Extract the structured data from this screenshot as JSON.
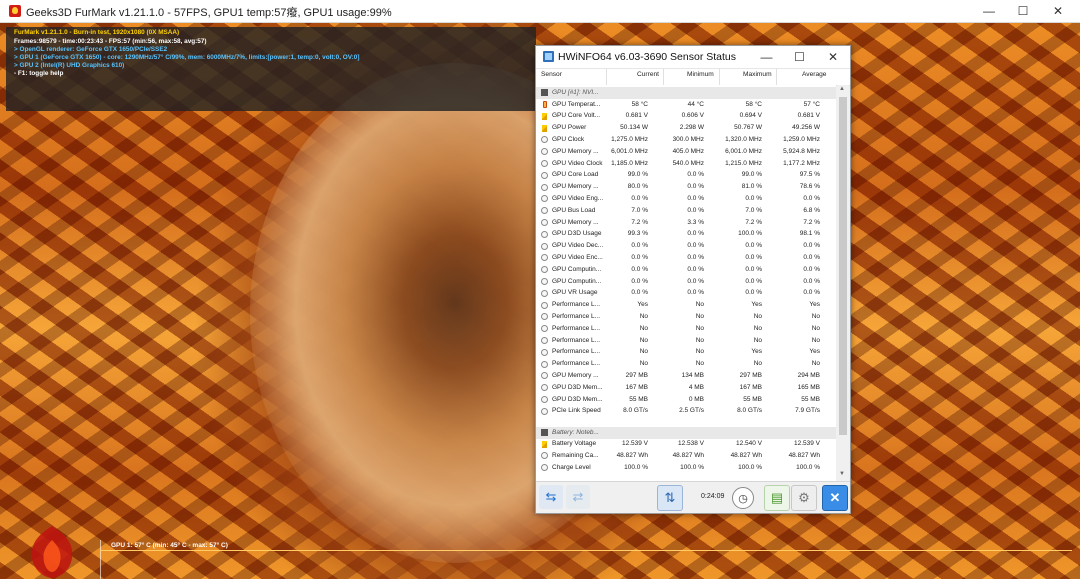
{
  "furmark": {
    "title": "Geeks3D FurMark v1.21.1.0 - 57FPS, GPU1 temp:57癈, GPU1 usage:99%",
    "overlay": [
      "FurMark v1.21.1.0 - Burn-in test, 1920x1080 (0X MSAA)",
      "Frames:98579 - time:00:23:43 - FPS:57 (min:56, max:58, avg:57)",
      "> OpenGL renderer: GeForce GTX 1650/PCIe/SSE2",
      "> GPU 1 (GeForce GTX 1650) - core: 1290MHz/57° C/99%, mem: 6000MHz/7%, limits:[power:1, temp:0, volt:0, OV:0]",
      "> GPU 2 (Intel(R) UHD Graphics 610)",
      "- F1: toggle help"
    ],
    "graph_label": "GPU 1: 57° C (min: 45° C - max: 57° C)",
    "colors": {
      "overlay_yellow": "#ffd200",
      "overlay_blue": "#57c3ff"
    }
  },
  "hwinfo": {
    "title": "HWiNFO64 v6.03-3690 Sensor Status",
    "columns": {
      "sensor": "Sensor",
      "current": "Current",
      "minimum": "Minimum",
      "maximum": "Maximum",
      "average": "Average"
    },
    "groups": {
      "gpu": "GPU [#1]: NVI...",
      "battery": "Battery: Noteb..."
    },
    "rows": [
      {
        "icon": "therm",
        "label": "GPU Temperat...",
        "current": "58 °C",
        "min": "44 °C",
        "max": "58 °C",
        "avg": "57 °C"
      },
      {
        "icon": "bolt",
        "label": "GPU Core Volt...",
        "current": "0.681 V",
        "min": "0.606 V",
        "max": "0.694 V",
        "avg": "0.681 V"
      },
      {
        "icon": "bolt",
        "label": "GPU Power",
        "current": "50.134 W",
        "min": "2.298 W",
        "max": "50.767 W",
        "avg": "49.256 W"
      },
      {
        "icon": "circle",
        "label": "GPU Clock",
        "current": "1,275.0 MHz",
        "min": "300.0 MHz",
        "max": "1,320.0 MHz",
        "avg": "1,259.0 MHz"
      },
      {
        "icon": "circle",
        "label": "GPU Memory ...",
        "current": "6,001.0 MHz",
        "min": "405.0 MHz",
        "max": "6,001.0 MHz",
        "avg": "5,924.8 MHz"
      },
      {
        "icon": "circle",
        "label": "GPU Video Clock",
        "current": "1,185.0 MHz",
        "min": "540.0 MHz",
        "max": "1,215.0 MHz",
        "avg": "1,177.2 MHz"
      },
      {
        "icon": "circle",
        "label": "GPU Core Load",
        "current": "99.0 %",
        "min": "0.0 %",
        "max": "99.0 %",
        "avg": "97.5 %"
      },
      {
        "icon": "circle",
        "label": "GPU Memory ...",
        "current": "80.0 %",
        "min": "0.0 %",
        "max": "81.0 %",
        "avg": "78.6 %"
      },
      {
        "icon": "circle",
        "label": "GPU Video Eng...",
        "current": "0.0 %",
        "min": "0.0 %",
        "max": "0.0 %",
        "avg": "0.0 %"
      },
      {
        "icon": "circle",
        "label": "GPU Bus Load",
        "current": "7.0 %",
        "min": "0.0 %",
        "max": "7.0 %",
        "avg": "6.8 %"
      },
      {
        "icon": "circle",
        "label": "GPU Memory ...",
        "current": "7.2 %",
        "min": "3.3 %",
        "max": "7.2 %",
        "avg": "7.2 %"
      },
      {
        "icon": "circle",
        "label": "GPU D3D Usage",
        "current": "99.3 %",
        "min": "0.0 %",
        "max": "100.0 %",
        "avg": "98.1 %"
      },
      {
        "icon": "circle",
        "label": "GPU Video Dec...",
        "current": "0.0 %",
        "min": "0.0 %",
        "max": "0.0 %",
        "avg": "0.0 %"
      },
      {
        "icon": "circle",
        "label": "GPU Video Enc...",
        "current": "0.0 %",
        "min": "0.0 %",
        "max": "0.0 %",
        "avg": "0.0 %"
      },
      {
        "icon": "circle",
        "label": "GPU Computin...",
        "current": "0.0 %",
        "min": "0.0 %",
        "max": "0.0 %",
        "avg": "0.0 %"
      },
      {
        "icon": "circle",
        "label": "GPU Computin...",
        "current": "0.0 %",
        "min": "0.0 %",
        "max": "0.0 %",
        "avg": "0.0 %"
      },
      {
        "icon": "circle",
        "label": "GPU VR Usage",
        "current": "0.0 %",
        "min": "0.0 %",
        "max": "0.0 %",
        "avg": "0.0 %"
      },
      {
        "icon": "circle",
        "label": "Performance L...",
        "current": "Yes",
        "min": "No",
        "max": "Yes",
        "avg": "Yes"
      },
      {
        "icon": "circle",
        "label": "Performance L...",
        "current": "No",
        "min": "No",
        "max": "No",
        "avg": "No"
      },
      {
        "icon": "circle",
        "label": "Performance L...",
        "current": "No",
        "min": "No",
        "max": "No",
        "avg": "No"
      },
      {
        "icon": "circle",
        "label": "Performance L...",
        "current": "No",
        "min": "No",
        "max": "No",
        "avg": "No"
      },
      {
        "icon": "circle",
        "label": "Performance L...",
        "current": "No",
        "min": "No",
        "max": "Yes",
        "avg": "Yes"
      },
      {
        "icon": "circle",
        "label": "Performance L...",
        "current": "No",
        "min": "No",
        "max": "No",
        "avg": "No"
      },
      {
        "icon": "circle",
        "label": "GPU Memory ...",
        "current": "297 MB",
        "min": "134 MB",
        "max": "297 MB",
        "avg": "294 MB"
      },
      {
        "icon": "circle",
        "label": "GPU D3D Mem...",
        "current": "167 MB",
        "min": "4 MB",
        "max": "167 MB",
        "avg": "165 MB"
      },
      {
        "icon": "circle",
        "label": "GPU D3D Mem...",
        "current": "55 MB",
        "min": "0 MB",
        "max": "55 MB",
        "avg": "55 MB"
      },
      {
        "icon": "circle",
        "label": "PCIe Link Speed",
        "current": "8.0 GT/s",
        "min": "2.5 GT/s",
        "max": "8.0 GT/s",
        "avg": "7.9 GT/s"
      }
    ],
    "battery_rows": [
      {
        "icon": "bolt",
        "label": "Battery Voltage",
        "current": "12.539 V",
        "min": "12.538 V",
        "max": "12.540 V",
        "avg": "12.539 V"
      },
      {
        "icon": "circle",
        "label": "Remaining Ca...",
        "current": "48.827 Wh",
        "min": "48.827 Wh",
        "max": "48.827 Wh",
        "avg": "48.827 Wh"
      },
      {
        "icon": "circle",
        "label": "Charge Level",
        "current": "100.0 %",
        "min": "100.0 %",
        "max": "100.0 %",
        "avg": "100.0 %"
      }
    ],
    "timer": "0:24:09",
    "icons": {
      "nav_left": "double-arrow-left-icon",
      "nav_right": "double-arrow-right-icon",
      "network": "network-icon",
      "clock": "clock-icon",
      "report": "report-icon",
      "settings": "settings-icon",
      "close": "close-sensors-icon"
    }
  }
}
